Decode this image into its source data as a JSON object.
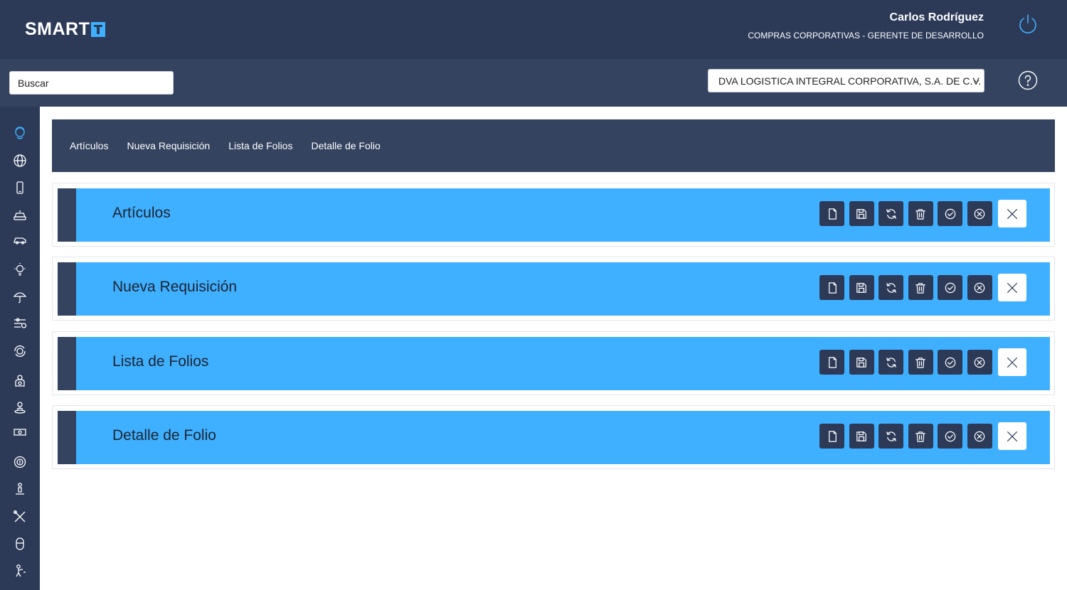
{
  "header": {
    "logo_text": "SMART",
    "user_name": "Carlos Rodríguez",
    "user_role": "COMPRAS CORPORATIVAS - GERENTE DE DESARROLLO",
    "power_icon": "power-icon"
  },
  "subbar": {
    "search_placeholder": "Buscar",
    "company_selected": "DVA LOGISTICA INTEGRAL CORPORATIVA, S.A. DE C.V.",
    "help_icon": "question-circle-icon"
  },
  "sidebar": {
    "items": [
      {
        "icon": "user-head-icon",
        "active": true
      },
      {
        "icon": "globe-icon"
      },
      {
        "icon": "mobile-phone-icon"
      },
      {
        "icon": "car-front-icon"
      },
      {
        "icon": "car-side-icon"
      },
      {
        "icon": "lightbulb-icon"
      },
      {
        "icon": "umbrella-icon"
      },
      {
        "icon": "sliders-money-icon"
      },
      {
        "icon": "coin-cycle-icon"
      },
      {
        "icon": "piggy-bank-icon"
      },
      {
        "icon": "person-pin-icon"
      },
      {
        "icon": "banknote-icon"
      },
      {
        "icon": "money-cycle-icon"
      },
      {
        "icon": "person-stand-icon"
      },
      {
        "icon": "tools-icon"
      },
      {
        "icon": "mouse-icon"
      },
      {
        "icon": "person-pointing-icon"
      }
    ]
  },
  "nav": {
    "links": [
      "Artículos",
      "Nueva Requisición",
      "Lista de Folios",
      "Detalle de Folio"
    ]
  },
  "cards": [
    {
      "title": "Artículos"
    },
    {
      "title": "Nueva Requisición"
    },
    {
      "title": "Lista de Folios"
    },
    {
      "title": "Detalle de Folio"
    }
  ],
  "actions": [
    "new-document-icon",
    "save-icon",
    "refresh-icon",
    "trash-icon",
    "check-circle-icon",
    "cancel-circle-icon",
    "close-icon"
  ],
  "colors": {
    "header_bg": "#2c3a58",
    "subbar_bg": "#34435f",
    "card_blue": "#3fb0ff",
    "accent": "#3fb0ff"
  }
}
